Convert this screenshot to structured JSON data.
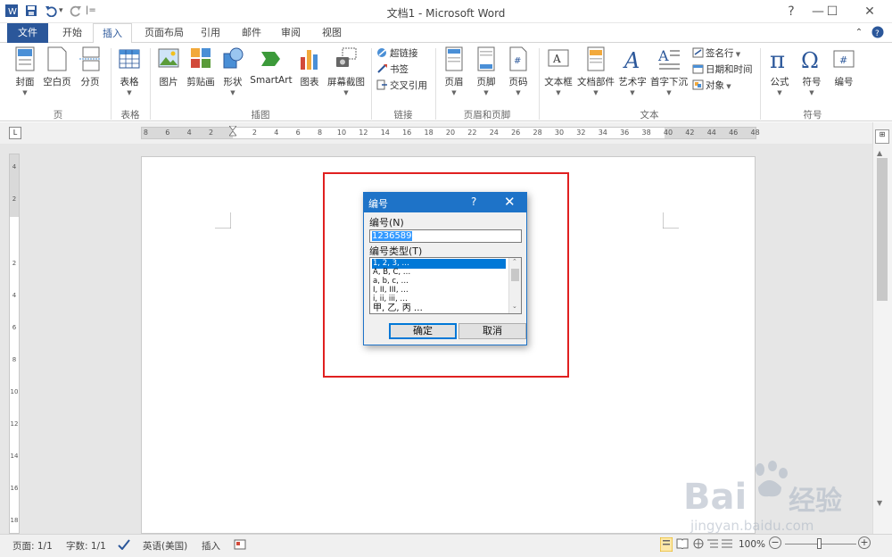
{
  "window": {
    "title": "文档1 - Microsoft Word",
    "controls": [
      "?",
      "—",
      "☐",
      "✕"
    ]
  },
  "qat": {
    "undo_arrow": "▾",
    "customize": "|="
  },
  "tabs": [
    {
      "label": "文件"
    },
    {
      "label": "开始"
    },
    {
      "label": "插入"
    },
    {
      "label": "页面布局"
    },
    {
      "label": "引用"
    },
    {
      "label": "邮件"
    },
    {
      "label": "审阅"
    },
    {
      "label": "视图"
    }
  ],
  "ribbon": {
    "groups": {
      "page": "页",
      "table": "表格",
      "illustrations": "插图",
      "links": "链接",
      "header_footer": "页眉和页脚",
      "text": "文本",
      "symbols": "符号"
    },
    "buttons": {
      "cover": "封面",
      "blank": "空白页",
      "break": "分页",
      "table": "表格",
      "picture": "图片",
      "clipart": "剪贴画",
      "shapes": "形状",
      "smartart": "SmartArt",
      "chart": "图表",
      "screenshot": "屏幕截图",
      "hyperlink": "超链接",
      "bookmark": "书签",
      "crossref": "交叉引用",
      "header": "页眉",
      "footer": "页脚",
      "pagenum": "页码",
      "textbox": "文本框",
      "quickparts": "文档部件",
      "wordart": "艺术字",
      "dropcap": "首字下沉",
      "signature": "签名行",
      "datetime": "日期和时间",
      "object": "对象",
      "equation": "公式",
      "symbol": "符号",
      "number": "编号"
    }
  },
  "ruler": {
    "left_labels": [
      "8",
      "6",
      "4",
      "2"
    ],
    "right_labels": [
      "2",
      "4",
      "6",
      "8",
      "10",
      "12",
      "14",
      "16",
      "18",
      "20",
      "22",
      "24",
      "26",
      "28",
      "30",
      "32",
      "34",
      "36",
      "38",
      "40",
      "42",
      "44",
      "46",
      "48"
    ],
    "vertical_labels": [
      "4",
      "2",
      "",
      "2",
      "4",
      "6",
      "8",
      "10",
      "12",
      "14",
      "16",
      "18"
    ]
  },
  "dialog": {
    "title": "编号",
    "help": "?",
    "close": "✕",
    "number_label": "编号(N)",
    "number_value": "1236589",
    "type_label": "编号类型(T)",
    "types": [
      "1, 2, 3, …",
      "A, B, C, …",
      "a, b, c, …",
      "I, II, III, …",
      "i, ii, iii, …",
      "甲, 乙, 丙 …"
    ],
    "ok": "确定",
    "cancel": "取消"
  },
  "status": {
    "page": "页面: 1/1",
    "words": "字数: 1/1",
    "language": "英语(美国)",
    "mode": "插入",
    "zoom": "100%",
    "zoom_minus": "−",
    "zoom_plus": "+"
  },
  "watermark": {
    "brand": "Bai",
    "brand_cn": "经验",
    "url": "jingyan.baidu.com"
  },
  "colors": {
    "accent": "#2b579a",
    "dialog_title": "#1e73c8",
    "highlight": "#e02020"
  }
}
